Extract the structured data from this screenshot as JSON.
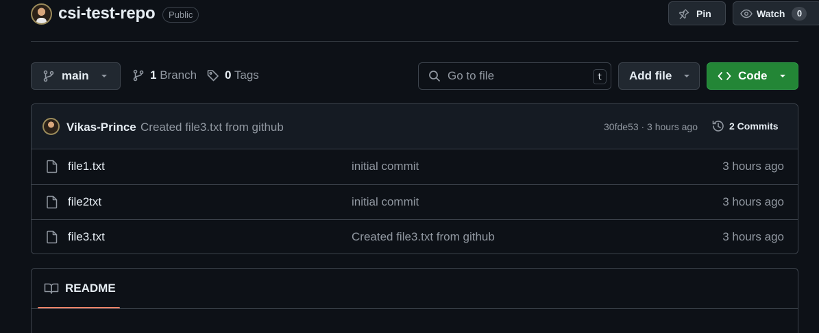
{
  "repo": {
    "name": "csi-test-repo",
    "visibility": "Public",
    "pin_label": "Pin",
    "watch_label": "Watch",
    "watch_count": "0"
  },
  "toolbar": {
    "branch": "main",
    "branch_count": "1",
    "branch_label": "Branch",
    "tag_count": "0",
    "tag_label": "Tags",
    "search_placeholder": "Go to file",
    "search_shortcut": "t",
    "add_file_label": "Add file",
    "code_label": "Code"
  },
  "latest_commit": {
    "author": "Vikas-Prince",
    "message": "Created file3.txt from github",
    "hash_time": "30fde53 · 3 hours ago",
    "commits_label": "2 Commits"
  },
  "files": [
    {
      "name": "file1.txt",
      "message": "initial commit",
      "time": "3 hours ago"
    },
    {
      "name": "file2txt",
      "message": "initial commit",
      "time": "3 hours ago"
    },
    {
      "name": "file3.txt",
      "message": "Created file3.txt from github",
      "time": "3 hours ago"
    }
  ],
  "readme": {
    "tab_label": "README"
  },
  "colors": {
    "background": "#0d1117",
    "border": "#3d444d",
    "code_button": "#238636",
    "readme_accent": "#f78166"
  },
  "icons": [
    "pin-icon",
    "eye-icon",
    "git-branch-icon",
    "tag-icon",
    "search-icon",
    "chevron-down-icon",
    "code-icon",
    "history-icon",
    "file-icon",
    "book-icon"
  ]
}
